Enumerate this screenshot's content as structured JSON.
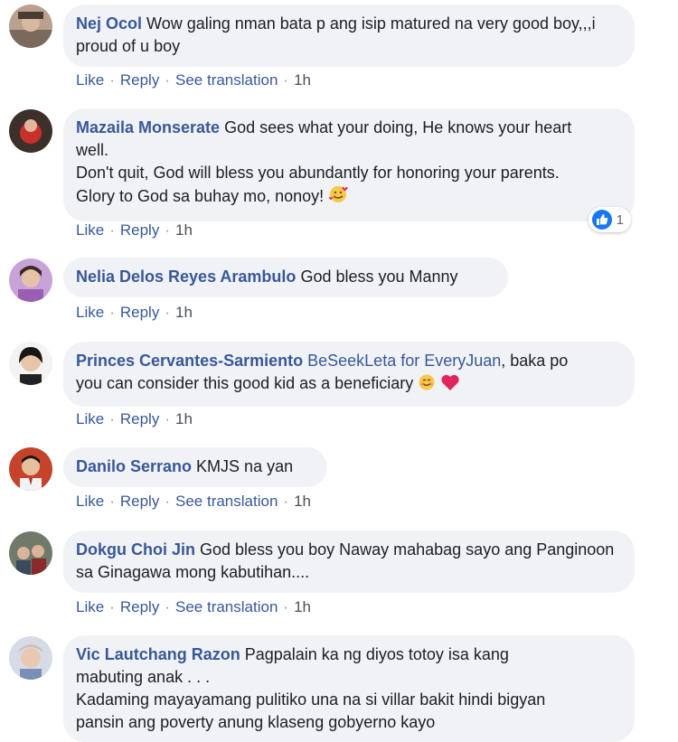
{
  "actions": {
    "like": "Like",
    "reply": "Reply",
    "see_translation": "See translation",
    "separator": "·"
  },
  "comments": [
    {
      "author": "Nej Ocol",
      "text": "Wow galing nman bata p ang isip matured na very good boy,,,i proud of u boy",
      "time": "1h",
      "translatable": true
    },
    {
      "author": "Mazaila Monserate",
      "text_lines": [
        "God sees what your doing, He knows your heart",
        "well.",
        "Don't quit, God will bless you abundantly for honoring your parents.",
        "Glory to God sa buhay mo, nonoy!"
      ],
      "emoji": "smiling-face-with-hearts",
      "time": "1h",
      "reaction_count": "1",
      "reaction_icon": "like-icon"
    },
    {
      "author": "Nelia Delos Reyes Arambulo",
      "text": "God bless you Manny",
      "time": "1h"
    },
    {
      "author": "Princes Cervantes-Sarmiento",
      "mention": "BeSeekLeta for EveryJuan",
      "text_line1": ", baka po",
      "text_line2": "you can consider this good kid as a beneficiary",
      "emojis": [
        "smiling-face",
        "red-heart"
      ],
      "time": "1h"
    },
    {
      "author": "Danilo Serrano",
      "text": "KMJS na yan",
      "time": "1h",
      "translatable": true
    },
    {
      "author": "Dokgu Choi Jin",
      "text": "God bless you boy Naway mahabag sayo ang Panginoon sa Ginagawa mong kabutihan....",
      "time": "1h",
      "translatable": true
    },
    {
      "author": "Vic Lautchang Razon",
      "text_lines": [
        "Pagpalain ka ng diyos totoy isa kang",
        "mabuting anak . . .",
        "Kadaming mayayamang pulitiko una na si villar bakit hindi bigyan",
        "pansin ang poverty anung klaseng gobyerno kayo"
      ]
    }
  ],
  "colors": {
    "author": "#385898",
    "bubble": "#f0f2f5",
    "like_badge": "#1877f2"
  }
}
